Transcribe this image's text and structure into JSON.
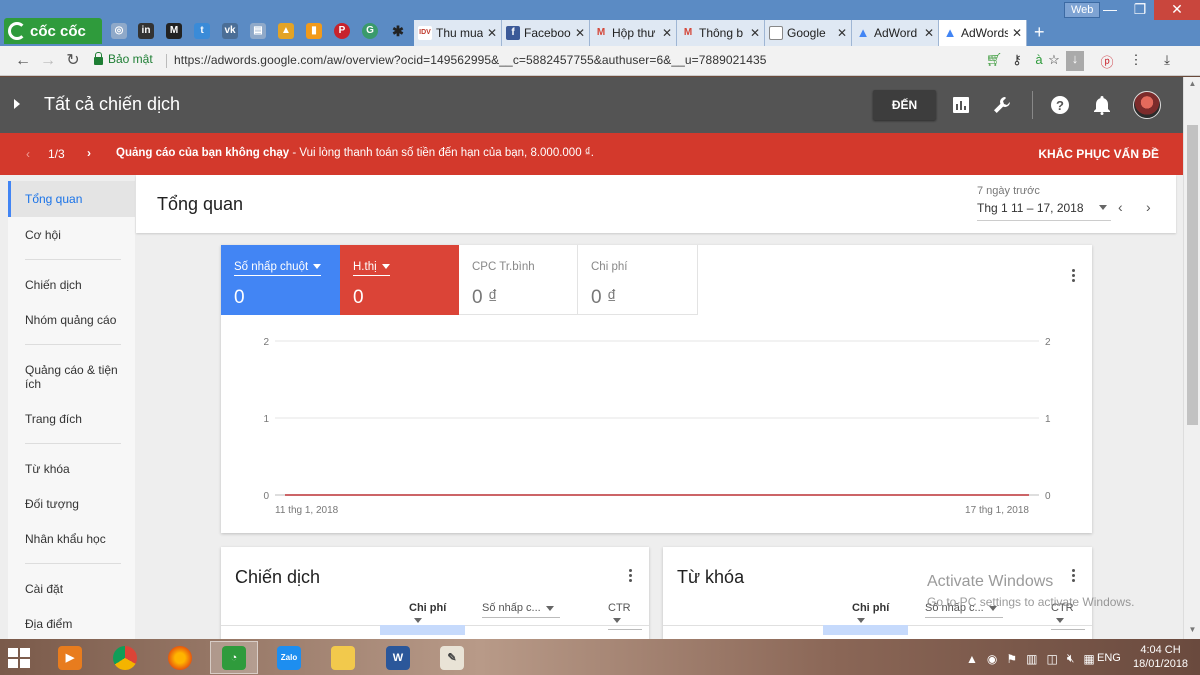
{
  "browser": {
    "brand": "cốc cốc",
    "web_button": "Web",
    "tabs": [
      {
        "title": "Thu mua"
      },
      {
        "title": "Faceboo"
      },
      {
        "title": "Hộp thư"
      },
      {
        "title": "Thông b"
      },
      {
        "title": "Google"
      },
      {
        "title": "AdWord"
      },
      {
        "title": "AdWords"
      }
    ],
    "secure_label": "Bảo mật",
    "url": "https://adwords.google.com/aw/overview?ocid=149562995&__c=5882457755&authuser=6&__u=7889021435"
  },
  "header": {
    "title": "Tất cả chiến dịch",
    "goto_label": "ĐẾN"
  },
  "alert": {
    "count": "1/3",
    "message_bold": "Quảng cáo của bạn không chạy",
    "message_rest": " - Vui lòng thanh toán số tiền đến hạn của bạn, 8.000.000 ₫.",
    "action": "KHẮC PHỤC VẤN ĐỀ"
  },
  "sidebar": {
    "items": [
      {
        "label": "Tổng quan"
      },
      {
        "label": "Cơ hội"
      },
      {
        "label": "Chiến dịch"
      },
      {
        "label": "Nhóm quảng cáo"
      },
      {
        "label": "Quảng cáo & tiện ích"
      },
      {
        "label": "Trang đích"
      },
      {
        "label": "Từ khóa"
      },
      {
        "label": "Đối tượng"
      },
      {
        "label": "Nhân khẩu học"
      },
      {
        "label": "Cài đặt"
      },
      {
        "label": "Địa điểm"
      }
    ]
  },
  "page": {
    "title": "Tổng quan",
    "date_relative": "7 ngày trước",
    "date_range": "Thg 1 11 – 17, 2018"
  },
  "metrics": [
    {
      "label": "Số nhấp chuột",
      "value": "0"
    },
    {
      "label": "H.thị",
      "value": "0"
    },
    {
      "label": "CPC Tr.bình",
      "value": "0 ₫"
    },
    {
      "label": "Chi phí",
      "value": "0 ₫"
    }
  ],
  "chart_data": {
    "type": "line",
    "x": [
      "11 thg 1, 2018",
      "17 thg 1, 2018"
    ],
    "x_tick_labels": [
      "11 thg 1, 2018",
      "17 thg 1, 2018"
    ],
    "y_ticks": [
      0,
      1,
      2
    ],
    "ylim": [
      0,
      2
    ],
    "grid": true,
    "series": [
      {
        "values": [
          0,
          0
        ],
        "color": "#4285f4"
      },
      {
        "values": [
          0,
          0
        ],
        "color": "#db4437"
      }
    ]
  },
  "campaigns_card": {
    "title": "Chiến dịch",
    "columns": [
      "Chi phí",
      "Số nhấp c...",
      "CTR"
    ]
  },
  "keywords_card": {
    "title": "Từ khóa",
    "columns": [
      "Chi phí",
      "Số nhấp c...",
      "CTR"
    ]
  },
  "watermark": {
    "line1": "Activate Windows",
    "line2": "Go to PC settings to activate Windows."
  },
  "taskbar": {
    "lang": "ENG",
    "time": "4:04 CH",
    "date": "18/01/2018"
  },
  "colors": {
    "header_bg": "#545454",
    "alert_bg": "#d3392c",
    "metric_blue": "#4285f4",
    "metric_red": "#db4437",
    "browser_tabbar": "#5b8bc4"
  }
}
